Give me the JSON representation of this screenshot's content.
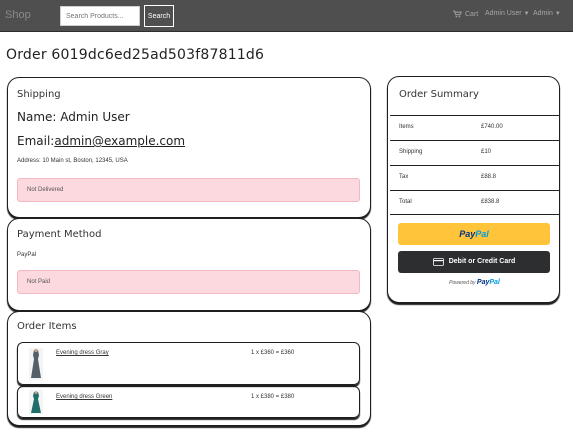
{
  "navbar": {
    "brand": "Shop",
    "search_placeholder": "Search Products...",
    "search_button": "Search",
    "cart_label": "Cart",
    "user_menu": "Admin User",
    "admin_menu": "Admin"
  },
  "order": {
    "title": "Order 6019dc6ed25ad503f87811d6"
  },
  "shipping": {
    "heading": "Shipping",
    "name": "Name: Admin User",
    "email_label": "Email:",
    "email": "admin@example.com",
    "address": "Address: 10 Main st, Boston, 12345, USA",
    "status": "Not Delivered"
  },
  "payment": {
    "heading": "Payment Method",
    "method": "PayPal",
    "status": "Not Paid"
  },
  "items": {
    "heading": "Order Items",
    "list": [
      {
        "name": "Evening dress Gray",
        "qty_price": "1 x £360 = £360",
        "color": "#555f68"
      },
      {
        "name": "Evening dress Green",
        "qty_price": "1 x £380 = £380",
        "color": "#1f6e6a"
      }
    ]
  },
  "summary": {
    "heading": "Order Summary",
    "rows": [
      {
        "label": "Items",
        "value": "£740.00"
      },
      {
        "label": "Shipping",
        "value": "£10"
      },
      {
        "label": "Tax",
        "value": "£88.8"
      },
      {
        "label": "Total",
        "value": "£838.8"
      }
    ],
    "paypal_button_a": "Pay",
    "paypal_button_b": "Pal",
    "card_button": "Debit or Credit Card",
    "powered_by": "Powered by",
    "powered_brand_a": "Pay",
    "powered_brand_b": "Pal"
  }
}
